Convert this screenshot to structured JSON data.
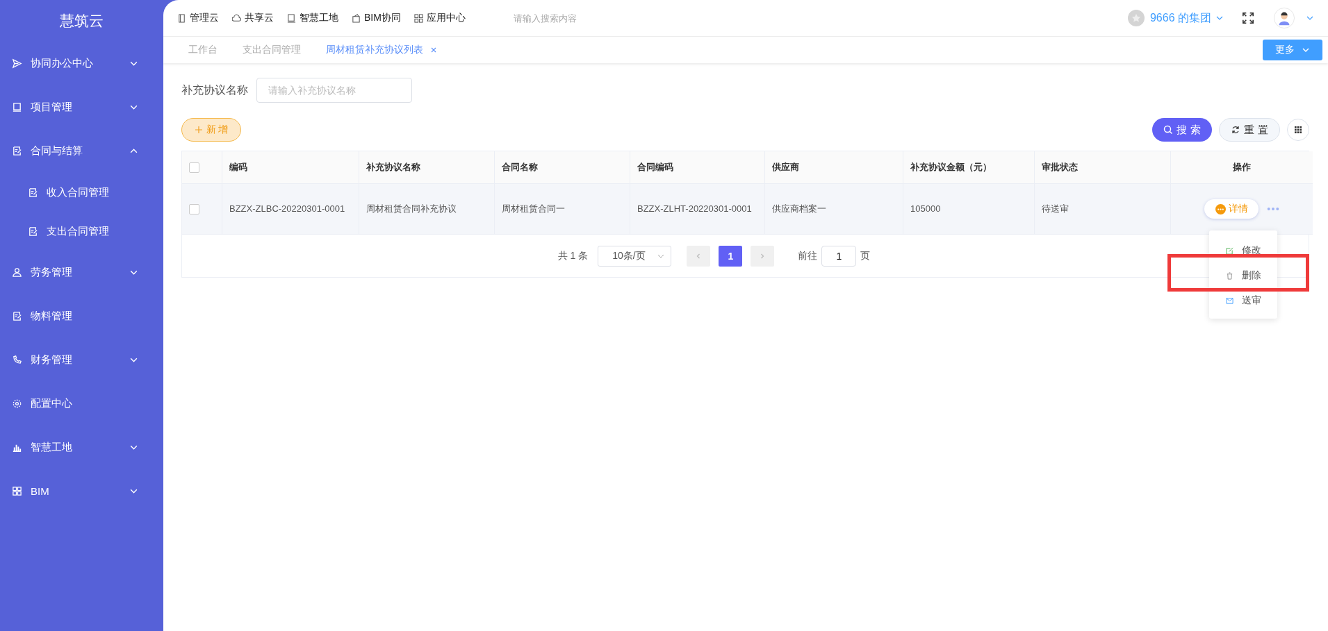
{
  "brand": "慧筑云",
  "sidebar": {
    "items": [
      {
        "label": "协同办公中心",
        "kind": "group",
        "expanded": false
      },
      {
        "label": "项目管理",
        "kind": "group",
        "expanded": false
      },
      {
        "label": "合同与结算",
        "kind": "group",
        "expanded": true,
        "children": [
          {
            "label": "收入合同管理"
          },
          {
            "label": "支出合同管理"
          }
        ]
      },
      {
        "label": "劳务管理",
        "kind": "group",
        "expanded": false
      },
      {
        "label": "物料管理",
        "kind": "leaf"
      },
      {
        "label": "财务管理",
        "kind": "group",
        "expanded": false
      },
      {
        "label": "配置中心",
        "kind": "leaf"
      },
      {
        "label": "智慧工地",
        "kind": "group",
        "expanded": false
      },
      {
        "label": "BIM",
        "kind": "group",
        "expanded": false
      }
    ]
  },
  "top_nav": [
    "管理云",
    "共享云",
    "智慧工地",
    "BIM协同",
    "应用中心"
  ],
  "top_search": {
    "placeholder": "请输入搜索内容"
  },
  "org": "9666 的集团",
  "tabs": [
    {
      "label": "工作台",
      "selected": false,
      "closable": false
    },
    {
      "label": "支出合同管理",
      "selected": false,
      "closable": false
    },
    {
      "label": "周材租赁补充协议列表",
      "selected": true,
      "closable": true
    }
  ],
  "more_button": "更多",
  "filter": {
    "label": "补充协议名称",
    "placeholder": "请输入补充协议名称"
  },
  "add_button": "新 增",
  "search_button": "搜 索",
  "reset_button": "重 置",
  "table": {
    "columns": [
      "编码",
      "补充协议名称",
      "合同名称",
      "合同编码",
      "供应商",
      "补充协议金额（元）",
      "审批状态",
      "操作"
    ],
    "rows": [
      {
        "checked": false,
        "cells": [
          "BZZX-ZLBC-20220301-0001",
          "周材租赁合同补充协议",
          "周材租赁合同一",
          "BZZX-ZLHT-20220301-0001",
          "供应商档案一",
          "105000",
          "待送审"
        ],
        "action": "详情"
      }
    ],
    "header_checked": false
  },
  "menu": [
    "修改",
    "删除",
    "送审"
  ],
  "pagination": {
    "total": "共 1 条",
    "page_size": "10条/页",
    "pages": [
      {
        "label": "1",
        "selected": true
      }
    ],
    "goto_label": "前往",
    "goto_value": "1",
    "goto_suffix": "页"
  }
}
